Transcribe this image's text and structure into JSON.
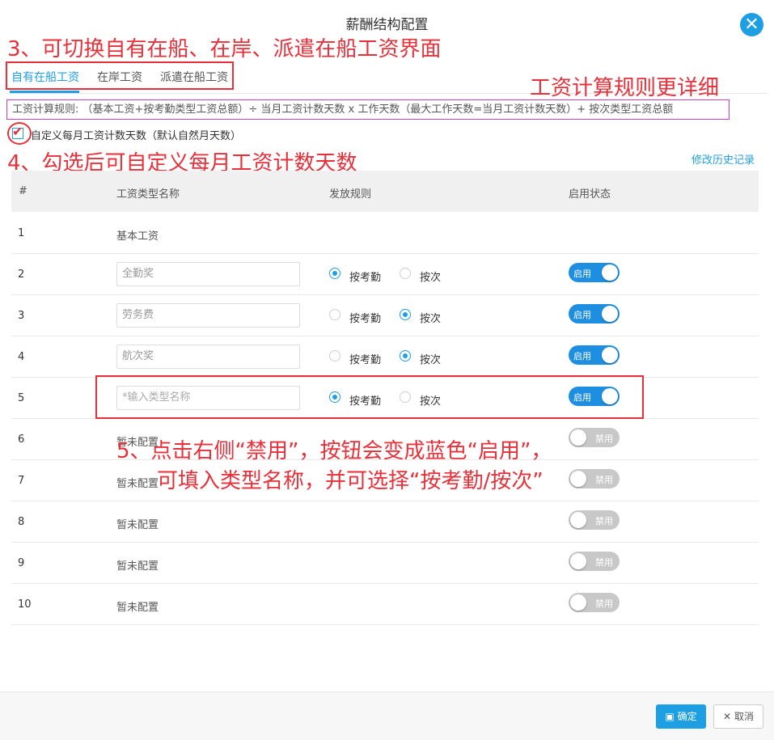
{
  "dialog": {
    "title": "薪酬结构配置",
    "close_icon": "close-icon",
    "accent_color": "#1e9fe4"
  },
  "annotations": {
    "note3": "3、可切换自有在船、在岸、派遣在船工资界面",
    "note_rule": "工资计算规则更详细",
    "note4": "4、勾选后可自定义每月工资计数天数",
    "note5_line1": "5、点击右侧“禁用”，按钮会变成蓝色“启用”，",
    "note5_line2": "可填入类型名称，并可选择“按考勤/按次”",
    "color": "#e8303a"
  },
  "tabs": [
    {
      "label": "自有在船工资",
      "active": true
    },
    {
      "label": "在岸工资",
      "active": false
    },
    {
      "label": "派遣在船工资",
      "active": false
    }
  ],
  "rule_text": "工资计算规则: （基本工资+按考勤类型工资总额）÷ 当月工资计数天数 x 工作天数（最大工作天数=当月工资计数天数）+ 按次类型工资总额",
  "custom_days": {
    "checked": true,
    "label": "自定义每月工资计数天数（默认自然月天数）"
  },
  "history_link": "修改历史记录",
  "table": {
    "headers": [
      "#",
      "工资类型名称",
      "发放规则",
      "启用状态"
    ],
    "radio_labels": [
      "按考勤",
      "按次"
    ],
    "rows": [
      {
        "num": "1",
        "name": "基本工资",
        "kind": "text"
      },
      {
        "num": "2",
        "name": "全勤奖",
        "kind": "input",
        "rule": "按考勤",
        "status": "启用",
        "enabled": true
      },
      {
        "num": "3",
        "name": "劳务费",
        "kind": "input",
        "rule": "按次",
        "status": "启用",
        "enabled": true
      },
      {
        "num": "4",
        "name": "航次奖",
        "kind": "input",
        "rule": "按次",
        "status": "启用",
        "enabled": true
      },
      {
        "num": "5",
        "placeholder": "*输入类型名称",
        "kind": "input",
        "rule": "按考勤",
        "status": "启用",
        "enabled": true
      },
      {
        "num": "6",
        "name": "暂未配置",
        "kind": "text",
        "status": "禁用",
        "enabled": false
      },
      {
        "num": "7",
        "name": "暂未配置",
        "kind": "text",
        "status": "禁用",
        "enabled": false
      },
      {
        "num": "8",
        "name": "暂未配置",
        "kind": "text",
        "status": "禁用",
        "enabled": false
      },
      {
        "num": "9",
        "name": "暂未配置",
        "kind": "text",
        "status": "禁用",
        "enabled": false
      },
      {
        "num": "10",
        "name": "暂未配置",
        "kind": "text",
        "status": "禁用",
        "enabled": false
      }
    ]
  },
  "footer": {
    "ok_label": "确定",
    "ok_icon": "save-icon",
    "cancel_label": "取消",
    "cancel_icon": "x-icon"
  }
}
